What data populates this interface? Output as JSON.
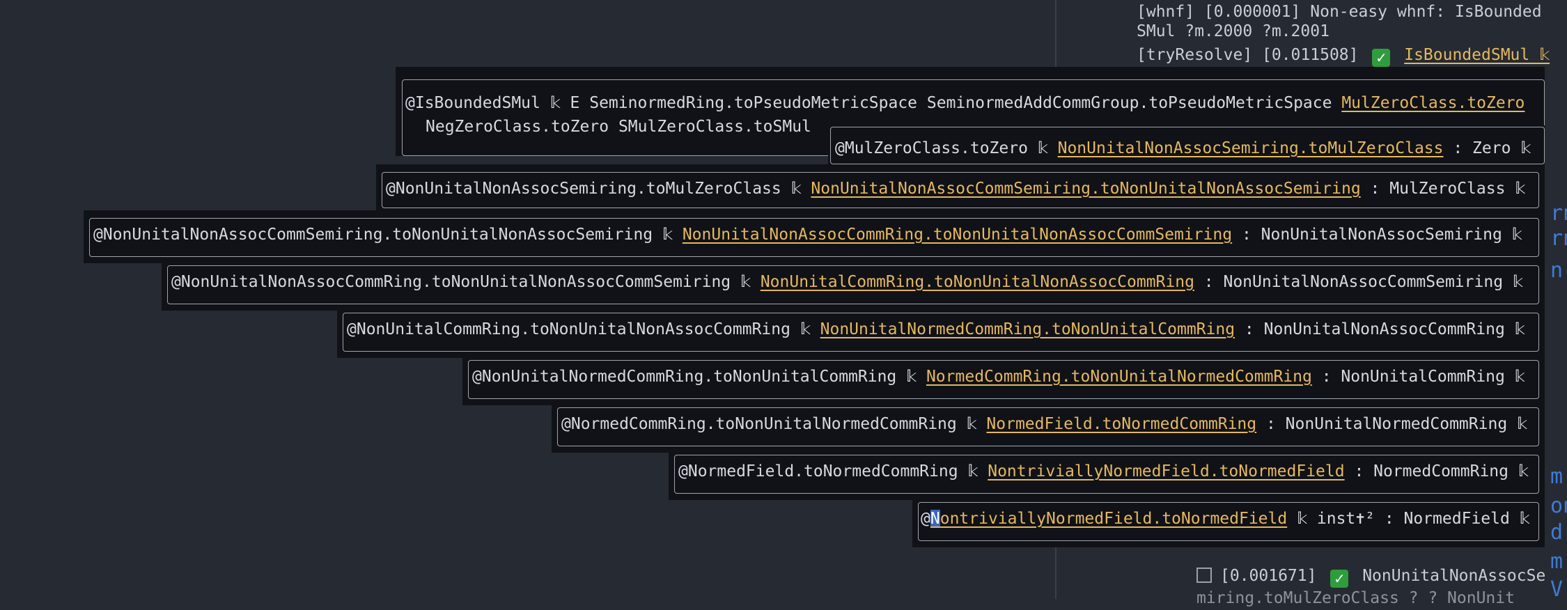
{
  "sidepanel": {
    "line1": "[whnf] [0.000001] Non-easy whnf: IsBounded",
    "line2": "SMul ?m.2000 ?m.2001",
    "line3_prefix": "[tryResolve] [0.011508]",
    "line3_link": "IsBoundedSMul 𝕜",
    "line4_time": "[0.001671]",
    "line4_text": "NonUnitalNonAssocSe",
    "line5": "miring.toMulZeroClass ? ?  NonUnit"
  },
  "edge_glyphs": [
    "rn",
    "rn",
    "n",
    "m",
    "on",
    "d",
    "m",
    "V"
  ],
  "popups": {
    "p1": {
      "line1_head": "@IsBoundedSMul 𝕜 E SeminormedRing.toPseudoMetricSpace SeminormedAddCommGroup.toPseudoMetricSpace ",
      "line1_link": "MulZeroClass.toZero",
      "line2": "NegZeroClass.toZero SMulZeroClass.toSMul"
    },
    "p2": {
      "head": "@MulZeroClass.toZero 𝕜 ",
      "link": "NonUnitalNonAssocSemiring.toMulZeroClass",
      "tail": " : Zero 𝕜"
    },
    "p3": {
      "head": "@NonUnitalNonAssocSemiring.toMulZeroClass 𝕜 ",
      "link": "NonUnitalNonAssocCommSemiring.toNonUnitalNonAssocSemiring",
      "tail": " : MulZeroClass 𝕜"
    },
    "p4": {
      "head": "@NonUnitalNonAssocCommSemiring.toNonUnitalNonAssocSemiring 𝕜 ",
      "link": "NonUnitalNonAssocCommRing.toNonUnitalNonAssocCommSemiring",
      "tail": " : NonUnitalNonAssocSemiring 𝕜"
    },
    "p5": {
      "head": "@NonUnitalNonAssocCommRing.toNonUnitalNonAssocCommSemiring 𝕜 ",
      "link": "NonUnitalCommRing.toNonUnitalNonAssocCommRing",
      "tail": " : NonUnitalNonAssocCommSemiring 𝕜"
    },
    "p6": {
      "head": "@NonUnitalCommRing.toNonUnitalNonAssocCommRing 𝕜 ",
      "link": "NonUnitalNormedCommRing.toNonUnitalCommRing",
      "tail": " : NonUnitalNonAssocCommRing 𝕜"
    },
    "p7": {
      "head": "@NonUnitalNormedCommRing.toNonUnitalCommRing 𝕜 ",
      "link": "NormedCommRing.toNonUnitalNormedCommRing",
      "tail": " : NonUnitalCommRing 𝕜"
    },
    "p8": {
      "head": "@NormedCommRing.toNonUnitalNormedCommRing 𝕜 ",
      "link": "NormedField.toNormedCommRing",
      "tail": " : NonUnitalNormedCommRing 𝕜"
    },
    "p9": {
      "head": "@NormedField.toNormedCommRing 𝕜 ",
      "link": "NontriviallyNormedField.toNormedField",
      "tail": " : NormedCommRing 𝕜"
    },
    "p10": {
      "at": "@",
      "cursor_char": "N",
      "link": "ontriviallyNormedField.toNormedField",
      "tail": " 𝕜 inst✝² : NormedField 𝕜"
    }
  }
}
